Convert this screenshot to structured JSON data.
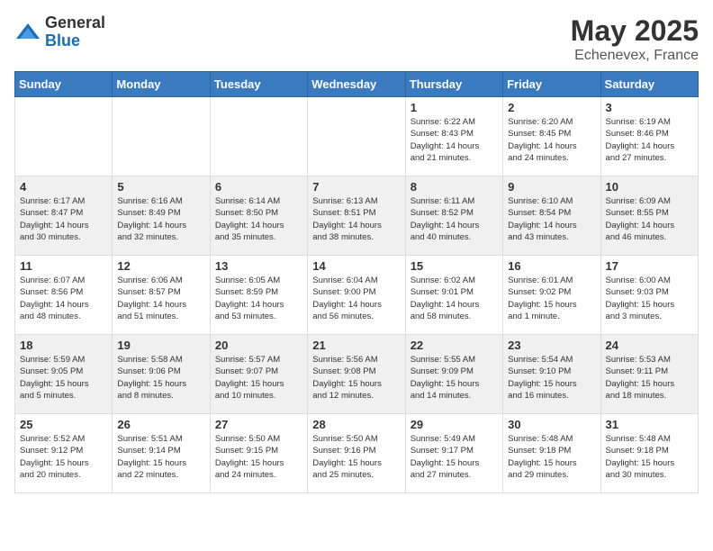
{
  "logo": {
    "general": "General",
    "blue": "Blue"
  },
  "title": {
    "month_year": "May 2025",
    "location": "Echenevex, France"
  },
  "weekdays": [
    "Sunday",
    "Monday",
    "Tuesday",
    "Wednesday",
    "Thursday",
    "Friday",
    "Saturday"
  ],
  "weeks": [
    [
      {
        "day": "",
        "info": ""
      },
      {
        "day": "",
        "info": ""
      },
      {
        "day": "",
        "info": ""
      },
      {
        "day": "",
        "info": ""
      },
      {
        "day": "1",
        "info": "Sunrise: 6:22 AM\nSunset: 8:43 PM\nDaylight: 14 hours\nand 21 minutes."
      },
      {
        "day": "2",
        "info": "Sunrise: 6:20 AM\nSunset: 8:45 PM\nDaylight: 14 hours\nand 24 minutes."
      },
      {
        "day": "3",
        "info": "Sunrise: 6:19 AM\nSunset: 8:46 PM\nDaylight: 14 hours\nand 27 minutes."
      }
    ],
    [
      {
        "day": "4",
        "info": "Sunrise: 6:17 AM\nSunset: 8:47 PM\nDaylight: 14 hours\nand 30 minutes."
      },
      {
        "day": "5",
        "info": "Sunrise: 6:16 AM\nSunset: 8:49 PM\nDaylight: 14 hours\nand 32 minutes."
      },
      {
        "day": "6",
        "info": "Sunrise: 6:14 AM\nSunset: 8:50 PM\nDaylight: 14 hours\nand 35 minutes."
      },
      {
        "day": "7",
        "info": "Sunrise: 6:13 AM\nSunset: 8:51 PM\nDaylight: 14 hours\nand 38 minutes."
      },
      {
        "day": "8",
        "info": "Sunrise: 6:11 AM\nSunset: 8:52 PM\nDaylight: 14 hours\nand 40 minutes."
      },
      {
        "day": "9",
        "info": "Sunrise: 6:10 AM\nSunset: 8:54 PM\nDaylight: 14 hours\nand 43 minutes."
      },
      {
        "day": "10",
        "info": "Sunrise: 6:09 AM\nSunset: 8:55 PM\nDaylight: 14 hours\nand 46 minutes."
      }
    ],
    [
      {
        "day": "11",
        "info": "Sunrise: 6:07 AM\nSunset: 8:56 PM\nDaylight: 14 hours\nand 48 minutes."
      },
      {
        "day": "12",
        "info": "Sunrise: 6:06 AM\nSunset: 8:57 PM\nDaylight: 14 hours\nand 51 minutes."
      },
      {
        "day": "13",
        "info": "Sunrise: 6:05 AM\nSunset: 8:59 PM\nDaylight: 14 hours\nand 53 minutes."
      },
      {
        "day": "14",
        "info": "Sunrise: 6:04 AM\nSunset: 9:00 PM\nDaylight: 14 hours\nand 56 minutes."
      },
      {
        "day": "15",
        "info": "Sunrise: 6:02 AM\nSunset: 9:01 PM\nDaylight: 14 hours\nand 58 minutes."
      },
      {
        "day": "16",
        "info": "Sunrise: 6:01 AM\nSunset: 9:02 PM\nDaylight: 15 hours\nand 1 minute."
      },
      {
        "day": "17",
        "info": "Sunrise: 6:00 AM\nSunset: 9:03 PM\nDaylight: 15 hours\nand 3 minutes."
      }
    ],
    [
      {
        "day": "18",
        "info": "Sunrise: 5:59 AM\nSunset: 9:05 PM\nDaylight: 15 hours\nand 5 minutes."
      },
      {
        "day": "19",
        "info": "Sunrise: 5:58 AM\nSunset: 9:06 PM\nDaylight: 15 hours\nand 8 minutes."
      },
      {
        "day": "20",
        "info": "Sunrise: 5:57 AM\nSunset: 9:07 PM\nDaylight: 15 hours\nand 10 minutes."
      },
      {
        "day": "21",
        "info": "Sunrise: 5:56 AM\nSunset: 9:08 PM\nDaylight: 15 hours\nand 12 minutes."
      },
      {
        "day": "22",
        "info": "Sunrise: 5:55 AM\nSunset: 9:09 PM\nDaylight: 15 hours\nand 14 minutes."
      },
      {
        "day": "23",
        "info": "Sunrise: 5:54 AM\nSunset: 9:10 PM\nDaylight: 15 hours\nand 16 minutes."
      },
      {
        "day": "24",
        "info": "Sunrise: 5:53 AM\nSunset: 9:11 PM\nDaylight: 15 hours\nand 18 minutes."
      }
    ],
    [
      {
        "day": "25",
        "info": "Sunrise: 5:52 AM\nSunset: 9:12 PM\nDaylight: 15 hours\nand 20 minutes."
      },
      {
        "day": "26",
        "info": "Sunrise: 5:51 AM\nSunset: 9:14 PM\nDaylight: 15 hours\nand 22 minutes."
      },
      {
        "day": "27",
        "info": "Sunrise: 5:50 AM\nSunset: 9:15 PM\nDaylight: 15 hours\nand 24 minutes."
      },
      {
        "day": "28",
        "info": "Sunrise: 5:50 AM\nSunset: 9:16 PM\nDaylight: 15 hours\nand 25 minutes."
      },
      {
        "day": "29",
        "info": "Sunrise: 5:49 AM\nSunset: 9:17 PM\nDaylight: 15 hours\nand 27 minutes."
      },
      {
        "day": "30",
        "info": "Sunrise: 5:48 AM\nSunset: 9:18 PM\nDaylight: 15 hours\nand 29 minutes."
      },
      {
        "day": "31",
        "info": "Sunrise: 5:48 AM\nSunset: 9:18 PM\nDaylight: 15 hours\nand 30 minutes."
      }
    ]
  ]
}
